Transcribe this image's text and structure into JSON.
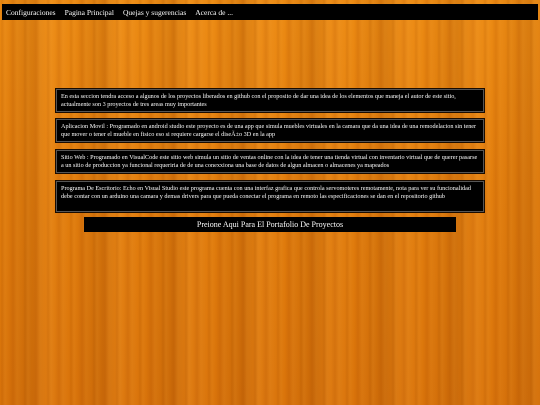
{
  "nav": {
    "items": [
      {
        "label": "Configuraciones"
      },
      {
        "label": "Pagina Principal"
      },
      {
        "label": "Quejas y sugerencias"
      },
      {
        "label": "Acerca de ..."
      }
    ]
  },
  "sections": {
    "intro": "En esta seccion tendra acceso a algunos de los proyectos liberados en github con el proposito de dar una idea de los elementos que maneja el autor de este sitio, actualmente son 3 proyectos de tres areas muy importantes",
    "mobile": "Aplicacion Movil : Programado en android studio este proyecto es de una app que simula muebles virtuales en la camara que da una idea de una remodelacion sin tener que mover o tener el mueble en fisico eso si requiere cargarse el diseÃ±o 3D en la app",
    "web": "Sitio Web : Programado en VisualCode este sitio web simula un sitio de ventas online con la idea de tener una tienda virtual con inventario virtual que de querer pasarse a un sitio de produccion ya funcional requeriria de de una conexxiona una base de datos de algun almacen o almacenes ya mapeados",
    "desktop": "Programa De Escritorio: Echo en Visual Studio este programa cuenta con una interfaz grafica que controla servomoteres remotamente, nota para ver su funcionalidad debe contar con un arduino una camara y demas drivers para que pueda conectar el programa en remoto las especificaciones se dan en el repositorio github"
  },
  "portfolio_button": {
    "label": "Preione Aqui Para El Portafolio De Proyectos"
  }
}
